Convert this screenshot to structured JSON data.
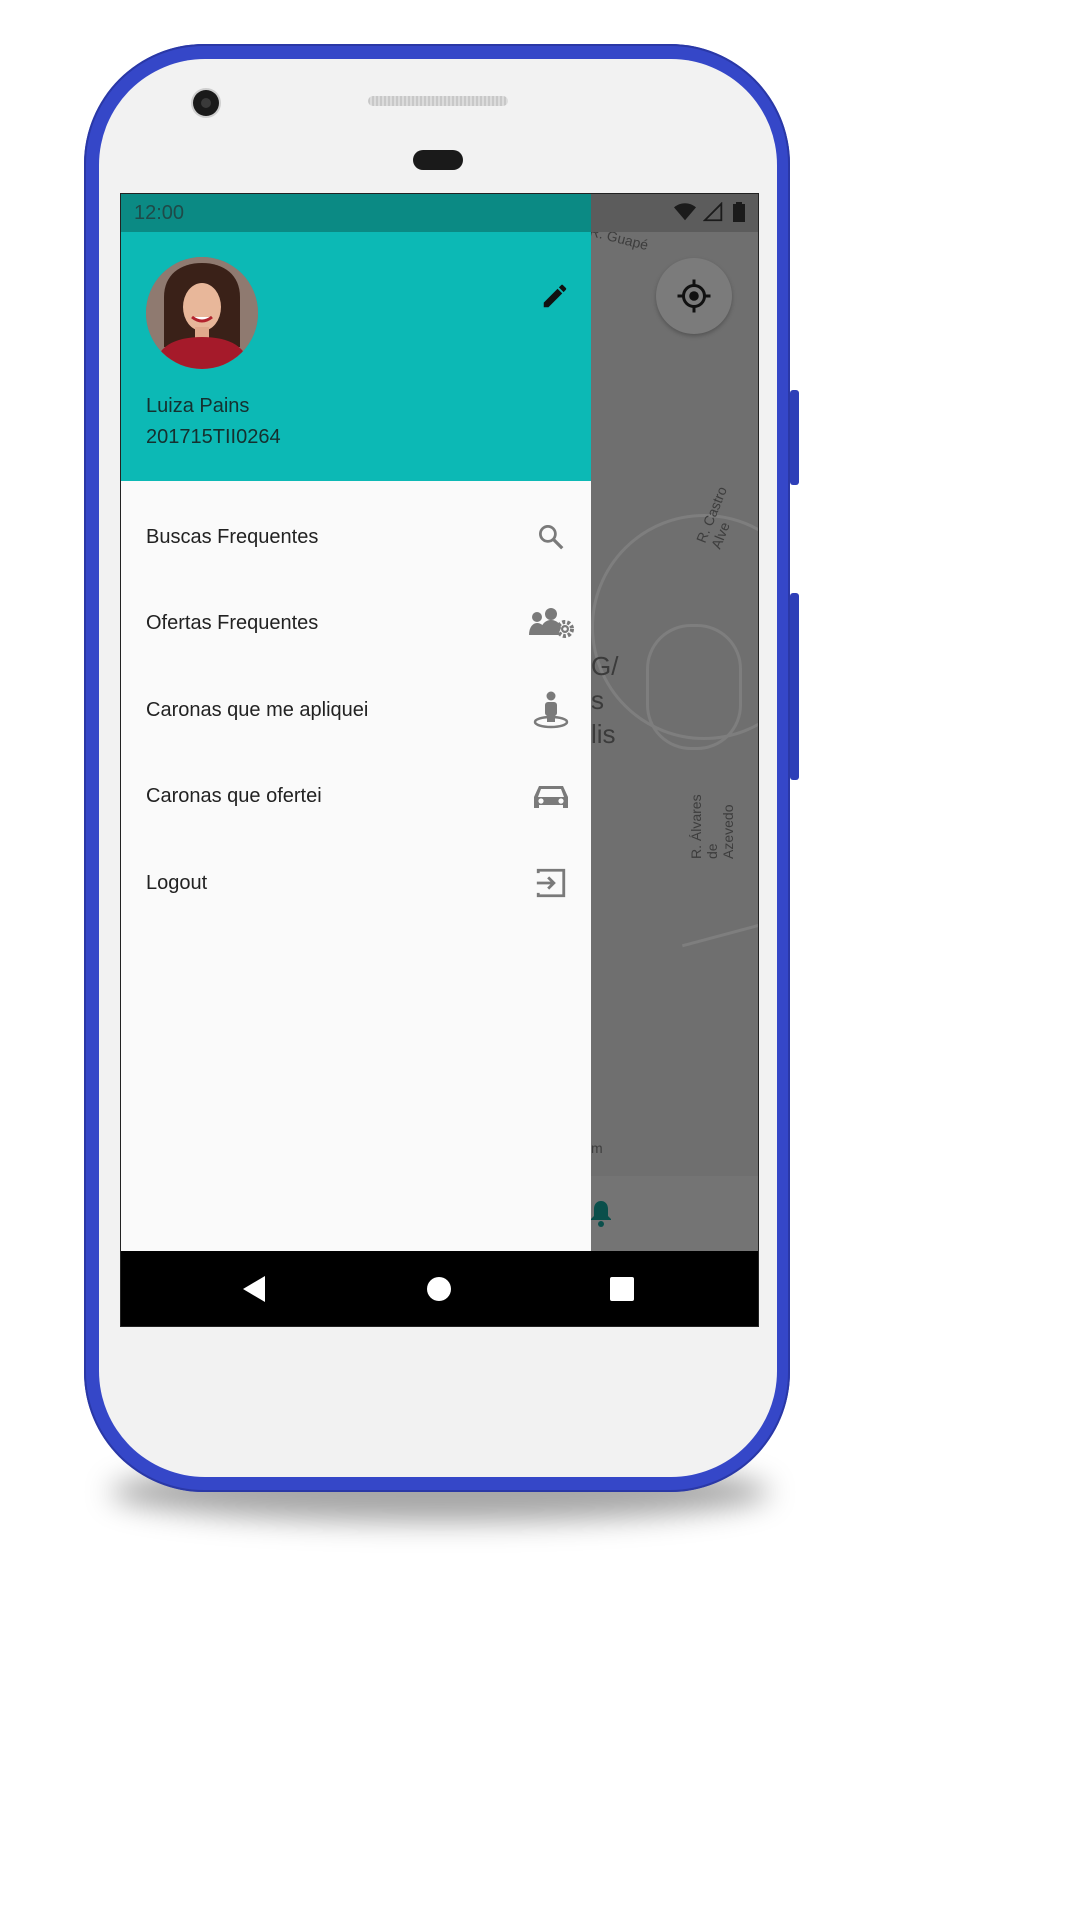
{
  "status_bar": {
    "time": "12:00"
  },
  "drawer": {
    "user": {
      "name": "Luiza Pains",
      "id": "201715TII0264"
    },
    "menu": [
      {
        "label": "Buscas Frequentes",
        "icon": "search-icon"
      },
      {
        "label": "Ofertas Frequentes",
        "icon": "users-gear-icon"
      },
      {
        "label": "Caronas que me apliquei",
        "icon": "person-pin-icon"
      },
      {
        "label": "Caronas que ofertei",
        "icon": "car-icon"
      },
      {
        "label": "Logout",
        "icon": "logout-icon"
      }
    ]
  },
  "map": {
    "labels": {
      "street_top": "R. Guapé",
      "street_right": "R. Castro Alve",
      "street_vertical": "R. Álvares de Azevedo",
      "place_line1": "G/",
      "place_line2": "s",
      "place_line3": "lis",
      "bottom_small": "m"
    }
  },
  "colors": {
    "header": "#0cb9b5",
    "status_bar": "#0b8a84",
    "frame": "#3547c8"
  }
}
